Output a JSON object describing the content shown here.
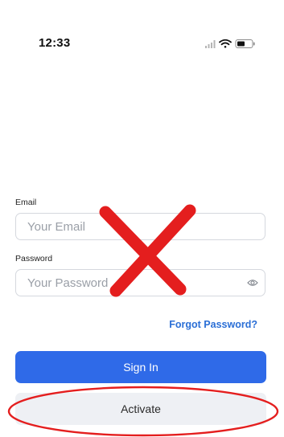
{
  "status_bar": {
    "time": "12:33",
    "icons": [
      "signal-icon",
      "wifi-icon",
      "battery-icon"
    ]
  },
  "form": {
    "email_label": "Email",
    "email_placeholder": "Your Email",
    "password_label": "Password",
    "password_placeholder": "Your Password",
    "forgot_password": "Forgot Password?"
  },
  "buttons": {
    "sign_in": "Sign In",
    "activate": "Activate"
  },
  "colors": {
    "primary": "#2f6ae8",
    "link": "#2b6fd6",
    "secondary_button_bg": "#eef0f4",
    "annotation_red": "#e41e1e"
  },
  "annotations": [
    "red-x-mark",
    "red-circle-highlight"
  ]
}
